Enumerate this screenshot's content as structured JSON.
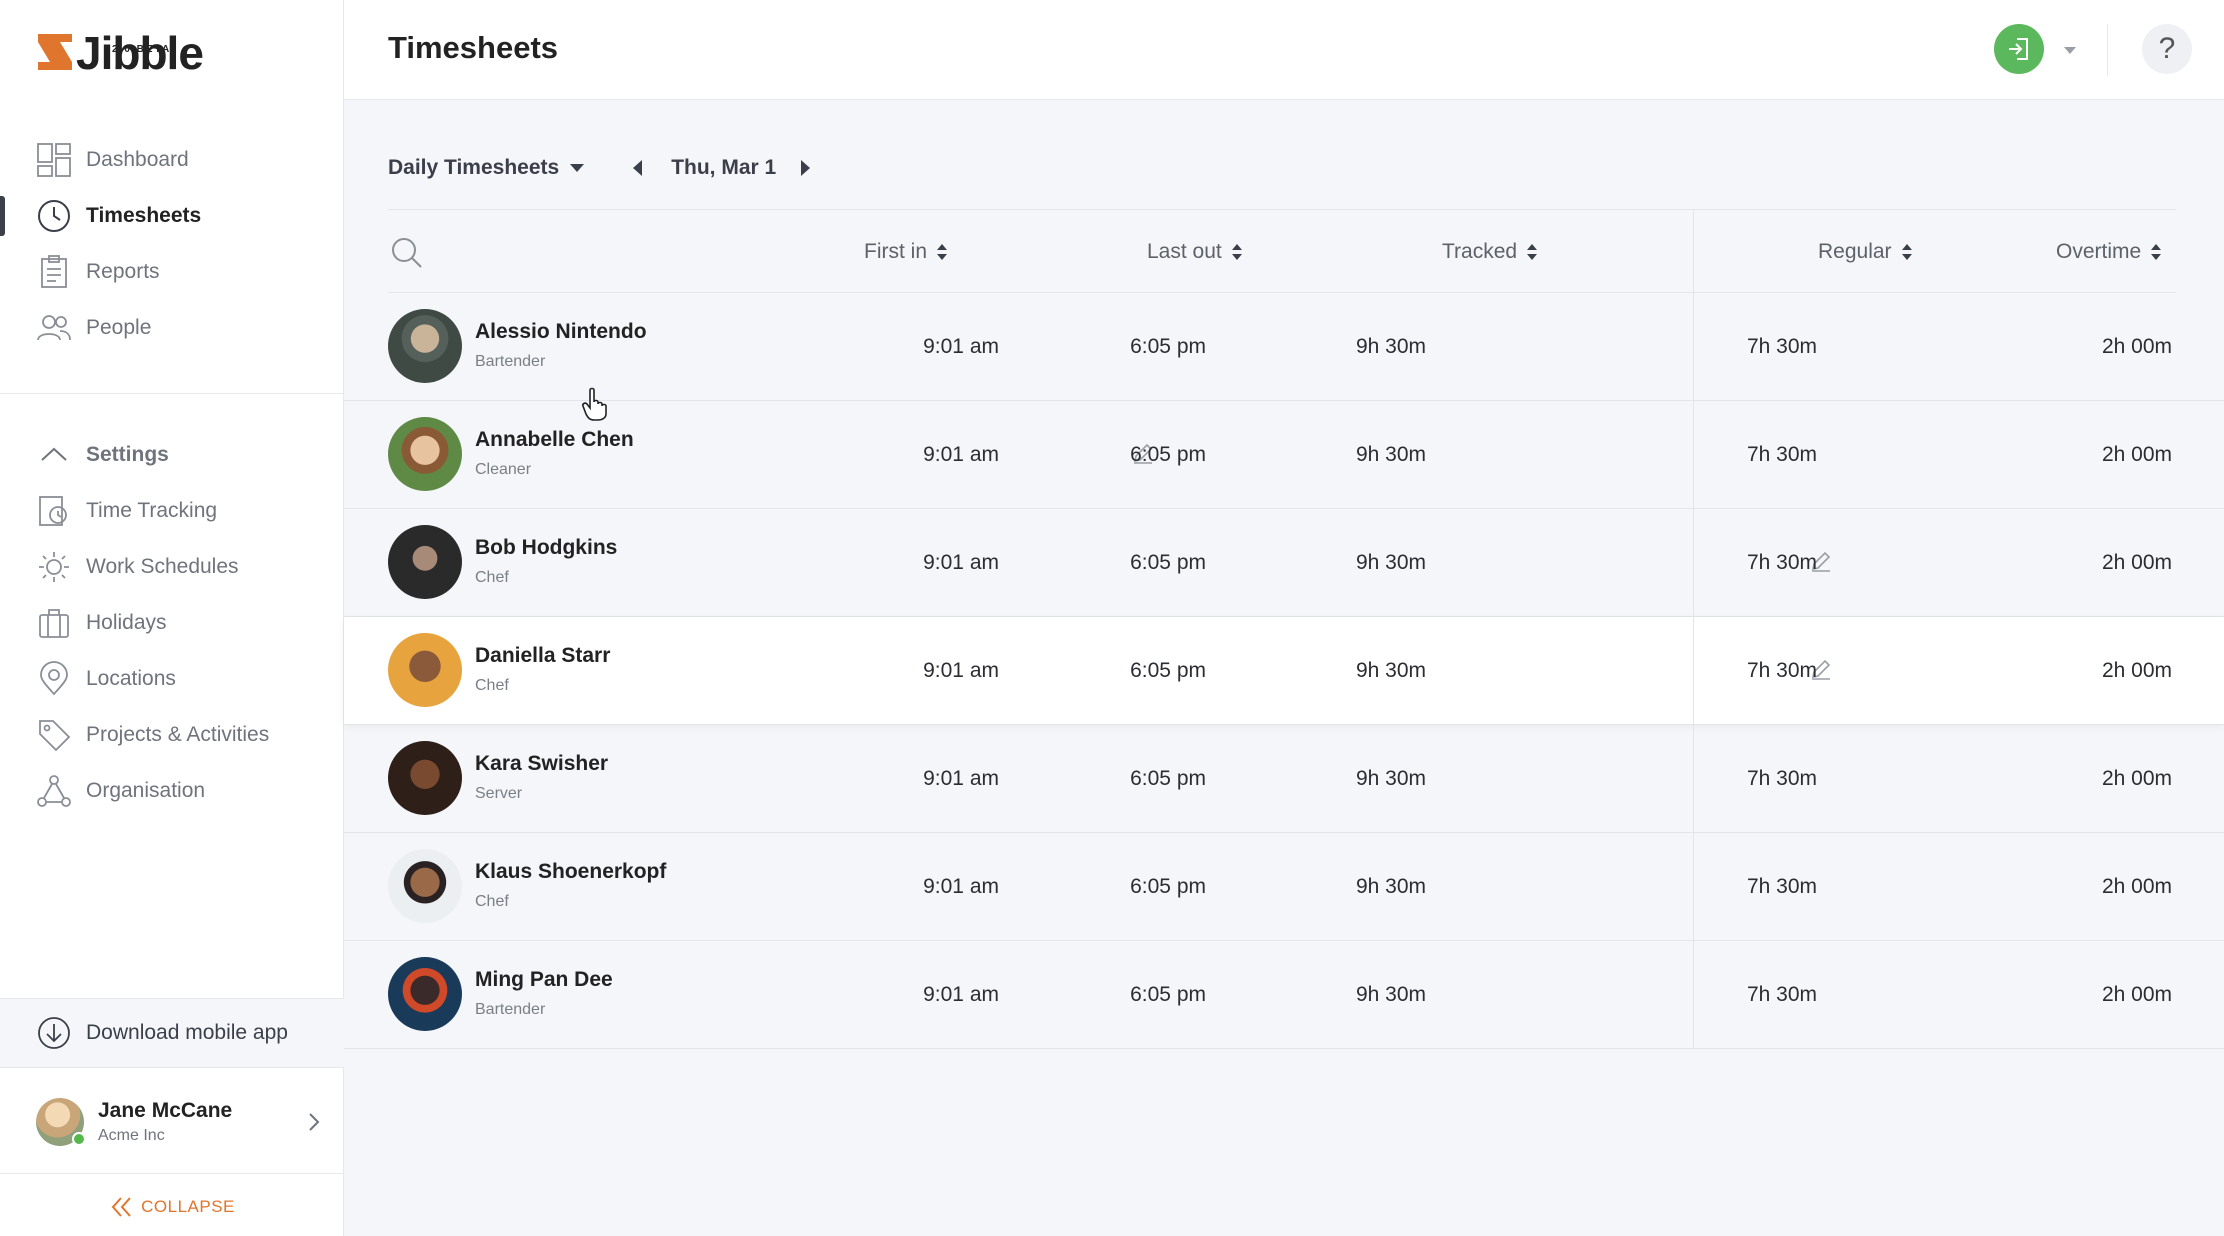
{
  "brand": {
    "name": "Jibble",
    "badge": "2.0 BETA",
    "accent": "#e0762e"
  },
  "nav": {
    "items": [
      {
        "label": "Dashboard",
        "icon": "dashboard-icon"
      },
      {
        "label": "Timesheets",
        "icon": "clock-icon",
        "active": true
      },
      {
        "label": "Reports",
        "icon": "clipboard-icon"
      },
      {
        "label": "People",
        "icon": "people-icon"
      }
    ],
    "settings_label": "Settings",
    "settings_items": [
      {
        "label": "Time Tracking",
        "icon": "time-tracking-icon"
      },
      {
        "label": "Work Schedules",
        "icon": "work-schedules-icon"
      },
      {
        "label": "Holidays",
        "icon": "suitcase-icon"
      },
      {
        "label": "Locations",
        "icon": "location-pin-icon"
      },
      {
        "label": "Projects & Activities",
        "icon": "tag-icon"
      },
      {
        "label": "Organisation",
        "icon": "organisation-icon"
      }
    ],
    "download_label": "Download mobile app",
    "collapse_label": "COLLAPSE"
  },
  "user": {
    "name": "Jane McCane",
    "org": "Acme Inc",
    "status_color": "#55b84a"
  },
  "header": {
    "title": "Timesheets",
    "help_symbol": "?"
  },
  "controls": {
    "view_label": "Daily Timesheets",
    "date_label": "Thu, Mar 1"
  },
  "columns": {
    "first_in": "First in",
    "last_out": "Last out",
    "tracked": "Tracked",
    "regular": "Regular",
    "overtime": "Overtime"
  },
  "rows": [
    {
      "name": "Alessio Nintendo",
      "role": "Bartender",
      "first_in": "9:01 am",
      "last_out": "6:05 pm",
      "tracked": "9h 30m",
      "regular": "7h 30m",
      "overtime": "2h 00m"
    },
    {
      "name": "Annabelle Chen",
      "role": "Cleaner",
      "first_in": "9:01 am",
      "last_out": "6:05 pm",
      "tracked": "9h 30m",
      "regular": "7h 30m",
      "overtime": "2h 00m",
      "edited": "last_out"
    },
    {
      "name": "Bob Hodgkins",
      "role": "Chef",
      "first_in": "9:01 am",
      "last_out": "6:05 pm",
      "tracked": "9h 30m",
      "regular": "7h 30m",
      "overtime": "2h 00m",
      "edited": "regular"
    },
    {
      "name": "Daniella Starr",
      "role": "Chef",
      "first_in": "9:01 am",
      "last_out": "6:05 pm",
      "tracked": "9h 30m",
      "regular": "7h 30m",
      "overtime": "2h 00m",
      "edited": "regular"
    },
    {
      "name": "Kara Swisher",
      "role": "Server",
      "first_in": "9:01 am",
      "last_out": "6:05 pm",
      "tracked": "9h 30m",
      "regular": "7h 30m",
      "overtime": "2h 00m"
    },
    {
      "name": "Klaus Shoenerkopf",
      "role": "Chef",
      "first_in": "9:01 am",
      "last_out": "6:05 pm",
      "tracked": "9h 30m",
      "regular": "7h 30m",
      "overtime": "2h 00m"
    },
    {
      "name": "Ming Pan Dee",
      "role": "Bartender",
      "first_in": "9:01 am",
      "last_out": "6:05 pm",
      "tracked": "9h 30m",
      "regular": "7h 30m",
      "overtime": "2h 00m"
    }
  ]
}
